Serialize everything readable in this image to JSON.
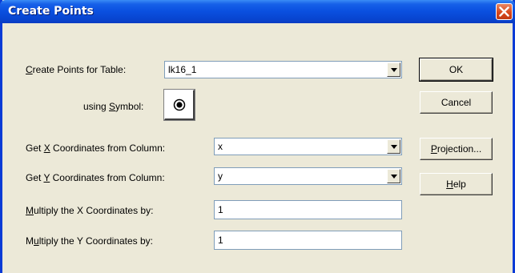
{
  "window": {
    "title": "Create Points"
  },
  "form": {
    "table_label_prefix": "",
    "table_label_access": "C",
    "table_label_rest": "reate Points for Table:",
    "table_value": "lk16_1",
    "symbol_label_prefix": "using ",
    "symbol_label_access": "S",
    "symbol_label_rest": "ymbol:",
    "symbol_icon": "filled-circle-icon",
    "x_label_prefix": "Get ",
    "x_label_access": "X",
    "x_label_rest": " Coordinates from Column:",
    "x_value": "x",
    "y_label_prefix": "Get ",
    "y_label_access": "Y",
    "y_label_rest": " Coordinates from Column:",
    "y_value": "y",
    "mult_x_label_prefix": "",
    "mult_x_label_access": "M",
    "mult_x_label_rest": "ultiply the X Coordinates by:",
    "mult_x_value": "1",
    "mult_y_label_prefix": "M",
    "mult_y_label_access": "u",
    "mult_y_label_rest": "ltiply the Y Coordinates by:",
    "mult_y_value": "1"
  },
  "buttons": {
    "ok": "OK",
    "cancel": "Cancel",
    "projection_access": "P",
    "projection_rest": "rojection...",
    "help_access": "H",
    "help_rest": "elp"
  },
  "colors": {
    "titlebar": "#0a4fdf",
    "close": "#d9481c",
    "dialog_bg": "#ece9d8"
  }
}
